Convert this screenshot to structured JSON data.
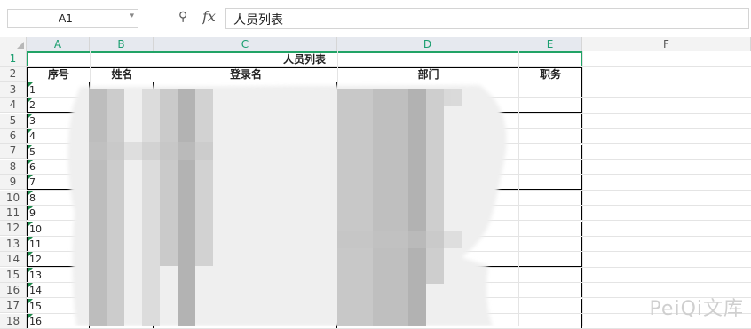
{
  "formula_bar": {
    "cell_ref": "A1",
    "formula_value": "人员列表",
    "fx_label": "fx"
  },
  "columns": [
    "A",
    "B",
    "C",
    "D",
    "E",
    "F"
  ],
  "rows": [
    "1",
    "2",
    "3",
    "4",
    "5",
    "6",
    "7",
    "8",
    "9",
    "10",
    "11",
    "12",
    "13",
    "14",
    "15",
    "16",
    "17",
    "18"
  ],
  "sheet": {
    "title": "人员列表",
    "headers": [
      "序号",
      "姓名",
      "登录名",
      "部门",
      "职务"
    ],
    "seq": [
      "1",
      "2",
      "3",
      "4",
      "5",
      "6",
      "7",
      "8",
      "9",
      "10",
      "11",
      "12",
      "13",
      "14",
      "15",
      "16"
    ]
  },
  "watermark": "PeiQi文库",
  "colors": {
    "selection": "#21a366",
    "header_selected": "#1a9e6f"
  }
}
